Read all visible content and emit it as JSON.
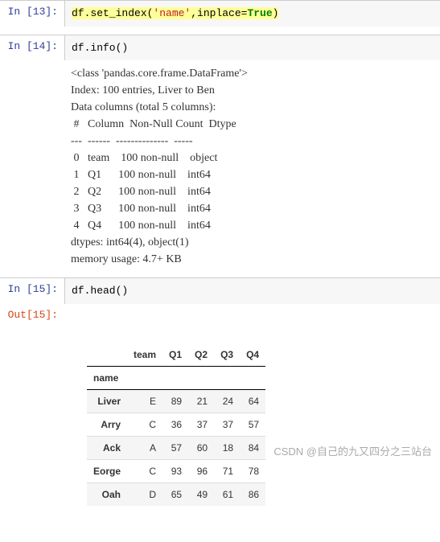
{
  "cells": {
    "c13": {
      "prompt": "In  [13]:",
      "code_pre": "df.set_index(",
      "code_str": "'name'",
      "code_mid": ",inplace=",
      "code_kw": "True",
      "code_post": ")"
    },
    "c14": {
      "prompt": "In  [14]:",
      "code": "df.info()"
    },
    "c14_out_lines": [
      "<class 'pandas.core.frame.DataFrame'>",
      "Index: 100 entries, Liver to Ben",
      "Data columns (total 5 columns):",
      " #   Column  Non-Null Count  Dtype ",
      "---  ------  --------------  ----- ",
      " 0   team    100 non-null    object",
      " 1   Q1      100 non-null    int64 ",
      " 2   Q2      100 non-null    int64 ",
      " 3   Q3      100 non-null    int64 ",
      " 4   Q4      100 non-null    int64 ",
      "dtypes: int64(4), object(1)",
      "memory usage: 4.7+ KB"
    ],
    "c15": {
      "prompt": "In  [15]:",
      "code": "df.head()"
    },
    "c15_out": {
      "prompt": "Out[15]:"
    }
  },
  "chart_data": {
    "type": "table",
    "index_name": "name",
    "columns": [
      "team",
      "Q1",
      "Q2",
      "Q3",
      "Q4"
    ],
    "rows": [
      {
        "name": "Liver",
        "team": "E",
        "Q1": 89,
        "Q2": 21,
        "Q3": 24,
        "Q4": 64
      },
      {
        "name": "Arry",
        "team": "C",
        "Q1": 36,
        "Q2": 37,
        "Q3": 37,
        "Q4": 57
      },
      {
        "name": "Ack",
        "team": "A",
        "Q1": 57,
        "Q2": 60,
        "Q3": 18,
        "Q4": 84
      },
      {
        "name": "Eorge",
        "team": "C",
        "Q1": 93,
        "Q2": 96,
        "Q3": 71,
        "Q4": 78
      },
      {
        "name": "Oah",
        "team": "D",
        "Q1": 65,
        "Q2": 49,
        "Q3": 61,
        "Q4": 86
      }
    ]
  },
  "watermark": "CSDN @自己的九又四分之三站台"
}
